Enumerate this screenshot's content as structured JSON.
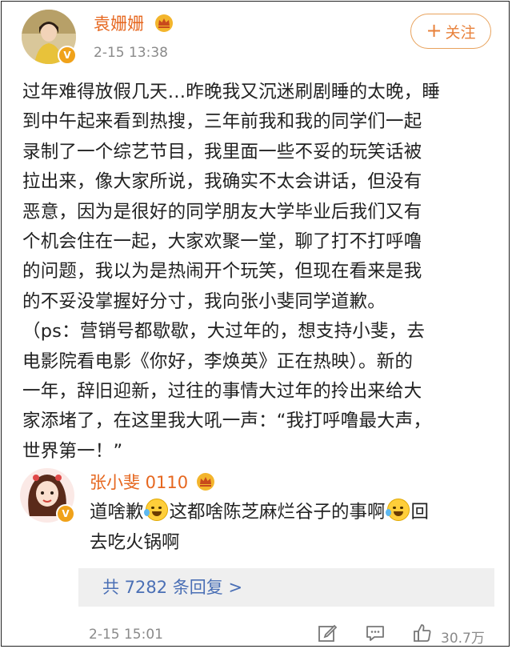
{
  "post": {
    "author": "袁姗姗",
    "time": "2-15 13:38",
    "follow_label": "关注",
    "content_lines": [
      "过年难得放假几天…昨晚我又沉迷刷剧睡的太晚，睡",
      "到中午起来看到热搜，三年前我和我的同学们一起",
      "录制了一个综艺节目，我里面一些不妥的玩笑话被",
      "拉出来，像大家所说，我确实不太会讲话，但没有",
      "恶意，因为是很好的同学朋友大学毕业后我们又有",
      "个机会住在一起，大家欢聚一堂，聊了打不打呼噜",
      "的问题，我以为是热闹开个玩笑，但现在看来是我",
      "的不妥没掌握好分寸，我向张小斐同学道歉。",
      "（ps：营销号都歇歇，大过年的，想支持小斐，去",
      "电影院看电影《你好，李焕英》正在热映）。新的",
      "一年，辞旧迎新，过往的事情大过年的拎出来给大",
      "家添堵了，在这里我大吼一声：“我打呼噜最大声，",
      "世界第一！”"
    ]
  },
  "reply": {
    "author": "张小斐 0110",
    "text_part1": "道啥歉",
    "text_part2": "这都啥陈芝麻烂谷子的事啊",
    "text_part3": "回",
    "text_part4": "去吃火锅啊",
    "more_replies": "共 7282 条回复 >",
    "time": "2-15 15:01",
    "likes": "30.7万"
  },
  "colors": {
    "name": "#e6671f",
    "link": "#4a6fb5",
    "badge": "#f0a21a"
  },
  "icons": [
    "crown-icon",
    "verified-badge-icon",
    "plus-icon",
    "edit-icon",
    "comment-icon",
    "like-icon",
    "cry-laugh-emoji",
    "laugh-emoji"
  ]
}
